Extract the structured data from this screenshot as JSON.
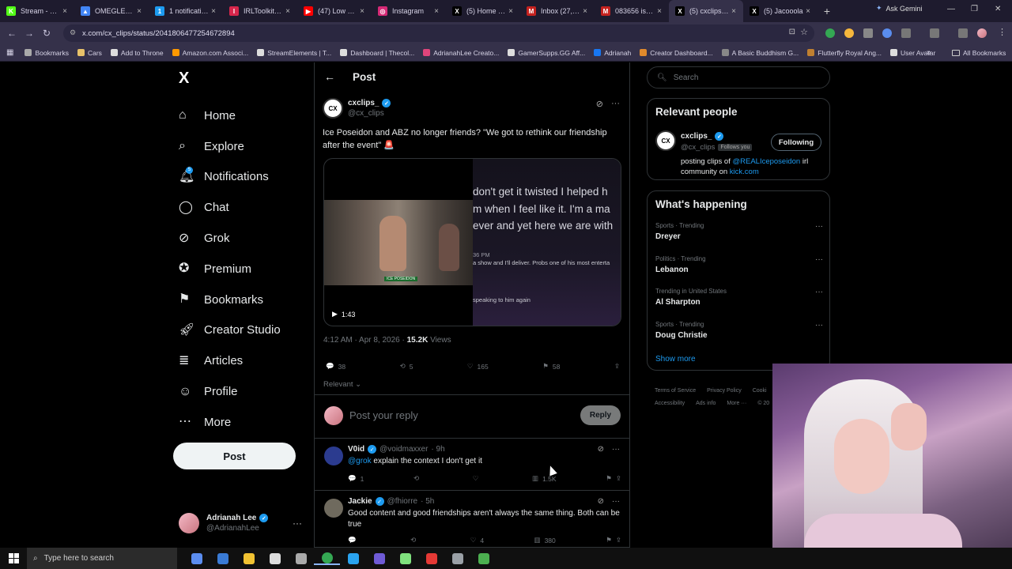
{
  "browser": {
    "tabs": [
      {
        "label": "Stream - Kick",
        "color": "#53fc18",
        "glyph": "K"
      },
      {
        "label": "OMEGLE 2026",
        "color": "#4285f4",
        "glyph": "▲"
      },
      {
        "label": "1 notification",
        "color": "#1d9bf0",
        "glyph": "1"
      },
      {
        "label": "IRLToolkit • D",
        "color": "#d6264b",
        "glyph": "I"
      },
      {
        "label": "(47) Low Cor",
        "color": "#ff0000",
        "glyph": "▶"
      },
      {
        "label": "Instagram",
        "color": "#d62976",
        "glyph": "◎"
      },
      {
        "label": "(5) Home / X",
        "color": "#000000",
        "glyph": "X"
      },
      {
        "label": "Inbox (27,86",
        "color": "#c5221f",
        "glyph": "M"
      },
      {
        "label": "083656 is yo",
        "color": "#c5221f",
        "glyph": "M"
      },
      {
        "label": "(5) cxclips_ c",
        "color": "#000000",
        "glyph": "X",
        "active": true
      },
      {
        "label": "(5) Jacooola",
        "color": "#000000",
        "glyph": "X"
      }
    ],
    "new_tab": "+",
    "ask_gemini": "Ask Gemini",
    "url": "x.com/cx_clips/status/2041806477254672894",
    "bookmarks": [
      {
        "label": "Bookmarks",
        "color": "#aaaaaa"
      },
      {
        "label": "Cars",
        "color": "#e8c26a"
      },
      {
        "label": "Add to Throne",
        "color": "#dddddd"
      },
      {
        "label": "Amazon.com Associ...",
        "color": "#ff9900"
      },
      {
        "label": "StreamElements | T...",
        "color": "#dddddd"
      },
      {
        "label": "Dashboard | Thecol...",
        "color": "#dddddd"
      },
      {
        "label": "AdrianahLee Creato...",
        "color": "#e0457b"
      },
      {
        "label": "GamerSupps.GG Aff...",
        "color": "#dddddd"
      },
      {
        "label": "Adrianah",
        "color": "#1877f2"
      },
      {
        "label": "Creator Dashboard...",
        "color": "#e08a2c"
      },
      {
        "label": "A Basic Buddhism G...",
        "color": "#888888"
      },
      {
        "label": "Flutterfly Royal Ang...",
        "color": "#c08030"
      },
      {
        "label": "User Avatar",
        "color": "#dddddd"
      }
    ],
    "all_bookmarks": "All Bookmarks"
  },
  "sidebar": {
    "logo": "X",
    "items": [
      {
        "label": "Home",
        "icon": "home-icon"
      },
      {
        "label": "Explore",
        "icon": "search-icon"
      },
      {
        "label": "Notifications",
        "icon": "bell-icon",
        "badge": "5"
      },
      {
        "label": "Chat",
        "icon": "chat-icon"
      },
      {
        "label": "Grok",
        "icon": "grok-icon"
      },
      {
        "label": "Premium",
        "icon": "premium-icon"
      },
      {
        "label": "Bookmarks",
        "icon": "bookmark-icon"
      },
      {
        "label": "Creator Studio",
        "icon": "rocket-icon"
      },
      {
        "label": "Articles",
        "icon": "articles-icon"
      },
      {
        "label": "Profile",
        "icon": "profile-icon"
      },
      {
        "label": "More",
        "icon": "more-icon"
      }
    ],
    "post_button": "Post",
    "account": {
      "name": "Adrianah Lee",
      "handle": "@AdrianahLee"
    }
  },
  "main": {
    "title": "Post",
    "post": {
      "author": "cxclips_",
      "handle": "@cx_clips",
      "avatar_text": "CX",
      "text": "Ice Poseidon and ABZ no longer friends? \"We got to rethink our friendship after the event\" 🚨",
      "media": {
        "lines_big": [
          "don't get it twisted I helped h",
          "m when I feel like it. I'm a ma",
          "ever and yet here we are with"
        ],
        "line_time": "36 PM",
        "line_small1": "a show and I'll deliver. Probs one of his most enterta",
        "line_small2": "speaking to him again",
        "duration": "1:43",
        "stream_tag": "ICE POSEIDON"
      },
      "time": "4:12 AM · Apr 8, 2026 · ",
      "views": "15.2K",
      "views_label": " Views",
      "stats": {
        "replies": "38",
        "reposts": "5",
        "likes": "165",
        "bookmarks": "58"
      }
    },
    "sort_label": "Relevant",
    "reply_placeholder": "Post your reply",
    "reply_button": "Reply",
    "replies": [
      {
        "name": "V0id",
        "handle": "@voidmaxxer",
        "time": "· 9h",
        "mention": "@grok",
        "text": " explain the context I don't get it",
        "stats": {
          "replies": "1",
          "reposts": "",
          "likes": "",
          "views": "1.5K"
        },
        "avatar_color": "#2b3b8f"
      },
      {
        "name": "Jackie",
        "handle": "@fhiorre",
        "time": "· 5h",
        "mention": "",
        "text": "Good content and good friendships aren't always the same thing. Both can be true",
        "stats": {
          "replies": "",
          "reposts": "",
          "likes": "4",
          "views": "380"
        },
        "avatar_color": "#6f6a5e"
      }
    ]
  },
  "right": {
    "search_placeholder": "Search",
    "relevant_title": "Relevant people",
    "person": {
      "name": "cxclips_",
      "handle": "@cx_clips",
      "follows_you": "Follows you",
      "follow_button": "Following",
      "bio_pre": "posting clips of ",
      "bio_link": "@REALIceposeidon",
      "bio_mid": " irl community on ",
      "bio_link2": "kick.com"
    },
    "happening_title": "What's happening",
    "trends": [
      {
        "context": "Sports · Trending",
        "name": "Dreyer"
      },
      {
        "context": "Politics · Trending",
        "name": "Lebanon"
      },
      {
        "context": "Trending in United States",
        "name": "Al Sharpton"
      },
      {
        "context": "Sports · Trending",
        "name": "Doug Christie"
      }
    ],
    "show_more": "Show more",
    "footer": [
      "Terms of Service",
      "Privacy Policy",
      "Cooki",
      "Accessibility",
      "Ads info",
      "More ···",
      "© 20"
    ]
  },
  "taskbar": {
    "search_placeholder": "Type here to search",
    "icons": [
      "copilot-icon",
      "task-view-icon",
      "file-explorer-icon",
      "settings-icon",
      "windows-app-icon",
      "chrome-icon",
      "edge-icon",
      "obs-icon",
      "streamlabs-icon",
      "opera-icon",
      "discord-icon",
      "terminal-icon"
    ],
    "icon_colors": [
      "#5b8def",
      "#3a7bd5",
      "#f1c232",
      "#dddddd",
      "#aaaaaa",
      "#34a853",
      "#2aa3ef",
      "#6f5bd6",
      "#80e27e",
      "#e53935",
      "#9aa0a6",
      "#4caf50"
    ]
  }
}
